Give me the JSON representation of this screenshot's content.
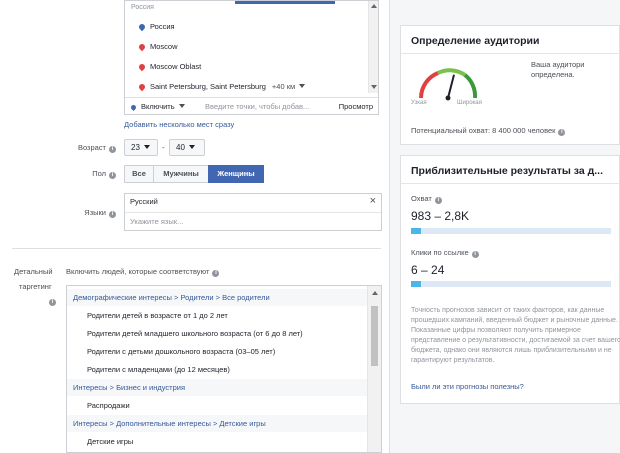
{
  "location": {
    "header": "Россия",
    "items": [
      {
        "name": "Россия",
        "pin": "blue-pin-icon"
      },
      {
        "name": "Moscow",
        "pin": "red-pin-icon"
      },
      {
        "name": "Moscow Oblast",
        "pin": "red-pin-icon"
      },
      {
        "name": "Saint Petersburg, Saint Petersburg",
        "radius": "+40 км",
        "pin": "red-pin-icon"
      }
    ],
    "include_label": "Включить",
    "input_placeholder": "Введите точки, чтобы добав...",
    "browse_label": "Просмотр",
    "add_many_link": "Добавить несколько мест сразу"
  },
  "age": {
    "label": "Возраст",
    "from": "23",
    "to": "40",
    "dash": "-"
  },
  "gender": {
    "label": "Пол",
    "options": [
      "Все",
      "Мужчины",
      "Женщины"
    ],
    "selected": "Женщины"
  },
  "languages": {
    "label": "Языки",
    "selected": "Русский",
    "placeholder": "Укажите язык...",
    "remove": "×"
  },
  "detailed": {
    "label_line1": "Детальный",
    "label_line2": "таргетинг",
    "include_text": "Включить людей, которые соответствуют",
    "groups": [
      {
        "path": "Демографические интересы > Родители > Все родители",
        "items": [
          "Родители детей в возрасте от 1 до 2 лет",
          "Родители детей младшего школьного возраста (от 6 до 8 лет)",
          "Родители с детьми дошкольного возраста (03–05 лет)",
          "Родители с младенцами (до 12 месяцев)"
        ]
      },
      {
        "path": "Интересы > Бизнес и индустрия",
        "items": [
          "Распродажи"
        ]
      },
      {
        "path": "Интересы > Дополнительные интересы > Детские игры",
        "items": [
          "Детские игры"
        ]
      }
    ]
  },
  "audience": {
    "title": "Определение аудитории",
    "narrow": "Узкая",
    "wide": "Широкая",
    "text_line1": "Ваша аудитори",
    "text_line2": "определена.",
    "reach": "Потенциальный охват: 8 400 000 человек",
    "gauge_level": 0.58
  },
  "results": {
    "title": "Приблизительные результаты за д...",
    "reach_label": "Охват",
    "reach_value": "983 – 2,8K",
    "reach_fill": 0.05,
    "clicks_label": "Клики по ссылке",
    "clicks_value": "6 – 24",
    "clicks_fill": 0.05,
    "note": "Точность прогнозов зависит от таких факторов, как данные прошедших кампаний, введенный бюджет и рыночные данные. Показанные цифры позволяют получить примерное представление о результативности, достигаемой за счет вашего бюджета, однако они являются лишь приблизительными и не гарантируют результатов.",
    "helpful": "Были ли эти прогнозы полезны?"
  }
}
